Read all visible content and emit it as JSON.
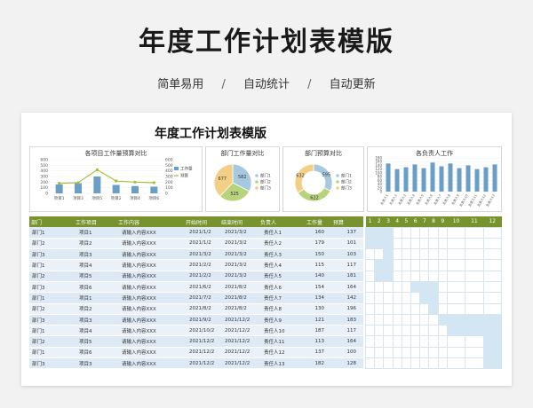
{
  "hero": {
    "title": "年度工作计划表模版",
    "tags": [
      "简单易用",
      "/",
      "自动统计",
      "/",
      "自动更新"
    ]
  },
  "sheet": {
    "title": "年度工作计划表模版"
  },
  "charts": [
    {
      "title": "各项目工作量预算对比",
      "type": "bar",
      "categories": [
        "项目1",
        "项目3",
        "项目5",
        "项目2",
        "项目4",
        "项目6"
      ],
      "left_axis_ticks": [
        "0",
        "100",
        "200",
        "300",
        "400",
        "500",
        "600"
      ],
      "right_axis_ticks": [
        "0",
        "100",
        "200",
        "300",
        "400",
        "500",
        "600"
      ],
      "legend": [
        "工作量",
        "预算"
      ],
      "series": [
        {
          "name": "工作量",
          "values": [
            160,
            180,
            300,
            150,
            130,
            120
          ]
        },
        {
          "name": "预算",
          "values": [
            180,
            190,
            420,
            220,
            200,
            190
          ]
        }
      ]
    },
    {
      "title": "部门工作量对比",
      "type": "pie",
      "labels": [
        "部门1",
        "部门2",
        "部门3"
      ],
      "values": [
        582,
        525,
        677
      ],
      "colors": [
        "#a7c9e0",
        "#b7d47c",
        "#f2cf85"
      ]
    },
    {
      "title": "部门预算对比",
      "type": "pie",
      "labels": [
        "部门1",
        "部门2",
        "部门3"
      ],
      "values": [
        595,
        622,
        632
      ],
      "colors": [
        "#a7c9e0",
        "#b7d47c",
        "#f2cf85"
      ]
    },
    {
      "title": "各负责人工作",
      "type": "bar",
      "y_ticks": [
        "0",
        "20",
        "40",
        "60",
        "80",
        "100",
        "120",
        "140",
        "160",
        "180"
      ],
      "categories": [
        "负责人1",
        "负责人2",
        "负责人3",
        "负责人4",
        "负责人5",
        "负责人6",
        "负责人7",
        "负责人8",
        "负责人9",
        "负责人10",
        "负责人11",
        "负责人12",
        "负责人13"
      ],
      "values": [
        150,
        120,
        130,
        145,
        125,
        155,
        135,
        150,
        125,
        140,
        120,
        130,
        145
      ],
      "color": "#6a9ec6"
    }
  ],
  "table": {
    "headers": [
      "部门",
      "工作项目",
      "工作内容",
      "开始时间",
      "结束时间",
      "负责人",
      "工作量",
      "预算"
    ],
    "month_headers": [
      "1",
      "2",
      "3",
      "4",
      "5",
      "6",
      "7",
      "8",
      "9",
      "10",
      "11",
      "12"
    ],
    "rows": [
      [
        "部门1",
        "项目1",
        "请输入内容XXX",
        "2021/1/2",
        "2021/3/2",
        "责任人1",
        "160",
        "137"
      ],
      [
        "部门2",
        "项目2",
        "请输入内容XXX",
        "2021/1/2",
        "2021/3/2",
        "责任人2",
        "179",
        "101"
      ],
      [
        "部门3",
        "项目3",
        "请输入内容XXX",
        "2021/3/2",
        "2021/3/2",
        "责任人3",
        "150",
        "103"
      ],
      [
        "部门1",
        "项目4",
        "请输入内容XXX",
        "2021/2/2",
        "2021/3/2",
        "责任人4",
        "115",
        "117"
      ],
      [
        "部门2",
        "项目5",
        "请输入内容XXX",
        "2021/2/2",
        "2021/3/2",
        "责任人5",
        "140",
        "181"
      ],
      [
        "部门3",
        "项目6",
        "请输入内容XXX",
        "2021/6/2",
        "2021/8/2",
        "责任人6",
        "154",
        "164"
      ],
      [
        "部门1",
        "项目1",
        "请输入内容XXX",
        "2021/7/2",
        "2021/8/2",
        "责任人7",
        "134",
        "142"
      ],
      [
        "部门2",
        "项目2",
        "请输入内容XXX",
        "2021/8/2",
        "2021/8/2",
        "责任人8",
        "130",
        "196"
      ],
      [
        "部门3",
        "项目3",
        "请输入内容XXX",
        "2021/9/2",
        "2021/12/2",
        "责任人9",
        "121",
        "183"
      ],
      [
        "部门1",
        "项目4",
        "请输入内容XXX",
        "2021/10/2",
        "2021/12/2",
        "责任人10",
        "187",
        "117"
      ],
      [
        "部门2",
        "项目5",
        "请输入内容XXX",
        "2021/12/2",
        "2021/12/2",
        "责任人11",
        "113",
        "164"
      ],
      [
        "部门1",
        "项目6",
        "请输入内容XXX",
        "2021/12/2",
        "2021/12/2",
        "责任人12",
        "137",
        "100"
      ],
      [
        "部门3",
        "项目3",
        "请输入内容XXX",
        "2021/12/2",
        "2021/12/2",
        "责任人13",
        "182",
        "128"
      ]
    ]
  }
}
